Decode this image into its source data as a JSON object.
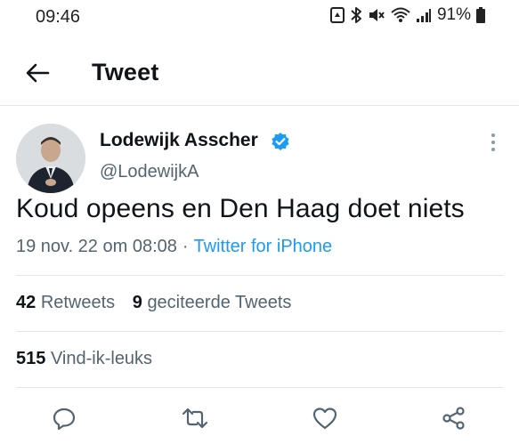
{
  "status_bar": {
    "time": "09:46",
    "battery": "91%"
  },
  "header": {
    "title": "Tweet"
  },
  "tweet": {
    "author_name": "Lodewijk Asscher",
    "author_handle": "@LodewijkA",
    "text": "Koud opeens en Den Haag doet niets",
    "timestamp": "19 nov. 22 om 08:08",
    "separator": "·",
    "source": "Twitter for iPhone"
  },
  "stats": {
    "retweets_count": "42",
    "retweets_label": "Retweets",
    "quotes_count": "9",
    "quotes_label": "geciteerde Tweets",
    "likes_count": "515",
    "likes_label": "Vind-ik-leuks"
  },
  "colors": {
    "accent": "#1d9bf0",
    "text": "#0f1419",
    "secondary": "#536471"
  },
  "icons": [
    "back-arrow-icon",
    "verified-badge-icon",
    "more-options-icon",
    "reply-icon",
    "retweet-icon",
    "like-icon",
    "share-icon"
  ]
}
